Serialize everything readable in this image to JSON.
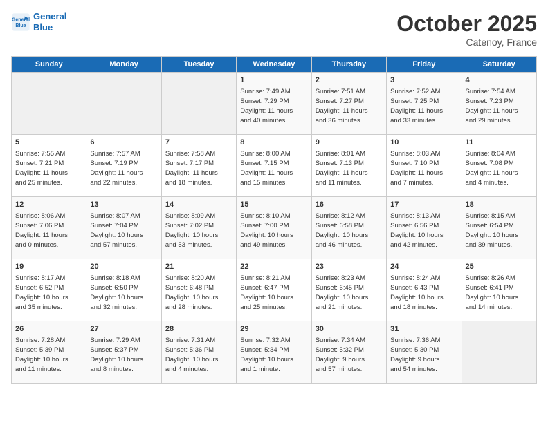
{
  "logo": {
    "line1": "General",
    "line2": "Blue"
  },
  "title": "October 2025",
  "location": "Catenoy, France",
  "days_of_week": [
    "Sunday",
    "Monday",
    "Tuesday",
    "Wednesday",
    "Thursday",
    "Friday",
    "Saturday"
  ],
  "weeks": [
    [
      {
        "day": "",
        "info": ""
      },
      {
        "day": "",
        "info": ""
      },
      {
        "day": "",
        "info": ""
      },
      {
        "day": "1",
        "info": "Sunrise: 7:49 AM\nSunset: 7:29 PM\nDaylight: 11 hours\nand 40 minutes."
      },
      {
        "day": "2",
        "info": "Sunrise: 7:51 AM\nSunset: 7:27 PM\nDaylight: 11 hours\nand 36 minutes."
      },
      {
        "day": "3",
        "info": "Sunrise: 7:52 AM\nSunset: 7:25 PM\nDaylight: 11 hours\nand 33 minutes."
      },
      {
        "day": "4",
        "info": "Sunrise: 7:54 AM\nSunset: 7:23 PM\nDaylight: 11 hours\nand 29 minutes."
      }
    ],
    [
      {
        "day": "5",
        "info": "Sunrise: 7:55 AM\nSunset: 7:21 PM\nDaylight: 11 hours\nand 25 minutes."
      },
      {
        "day": "6",
        "info": "Sunrise: 7:57 AM\nSunset: 7:19 PM\nDaylight: 11 hours\nand 22 minutes."
      },
      {
        "day": "7",
        "info": "Sunrise: 7:58 AM\nSunset: 7:17 PM\nDaylight: 11 hours\nand 18 minutes."
      },
      {
        "day": "8",
        "info": "Sunrise: 8:00 AM\nSunset: 7:15 PM\nDaylight: 11 hours\nand 15 minutes."
      },
      {
        "day": "9",
        "info": "Sunrise: 8:01 AM\nSunset: 7:13 PM\nDaylight: 11 hours\nand 11 minutes."
      },
      {
        "day": "10",
        "info": "Sunrise: 8:03 AM\nSunset: 7:10 PM\nDaylight: 11 hours\nand 7 minutes."
      },
      {
        "day": "11",
        "info": "Sunrise: 8:04 AM\nSunset: 7:08 PM\nDaylight: 11 hours\nand 4 minutes."
      }
    ],
    [
      {
        "day": "12",
        "info": "Sunrise: 8:06 AM\nSunset: 7:06 PM\nDaylight: 11 hours\nand 0 minutes."
      },
      {
        "day": "13",
        "info": "Sunrise: 8:07 AM\nSunset: 7:04 PM\nDaylight: 10 hours\nand 57 minutes."
      },
      {
        "day": "14",
        "info": "Sunrise: 8:09 AM\nSunset: 7:02 PM\nDaylight: 10 hours\nand 53 minutes."
      },
      {
        "day": "15",
        "info": "Sunrise: 8:10 AM\nSunset: 7:00 PM\nDaylight: 10 hours\nand 49 minutes."
      },
      {
        "day": "16",
        "info": "Sunrise: 8:12 AM\nSunset: 6:58 PM\nDaylight: 10 hours\nand 46 minutes."
      },
      {
        "day": "17",
        "info": "Sunrise: 8:13 AM\nSunset: 6:56 PM\nDaylight: 10 hours\nand 42 minutes."
      },
      {
        "day": "18",
        "info": "Sunrise: 8:15 AM\nSunset: 6:54 PM\nDaylight: 10 hours\nand 39 minutes."
      }
    ],
    [
      {
        "day": "19",
        "info": "Sunrise: 8:17 AM\nSunset: 6:52 PM\nDaylight: 10 hours\nand 35 minutes."
      },
      {
        "day": "20",
        "info": "Sunrise: 8:18 AM\nSunset: 6:50 PM\nDaylight: 10 hours\nand 32 minutes."
      },
      {
        "day": "21",
        "info": "Sunrise: 8:20 AM\nSunset: 6:48 PM\nDaylight: 10 hours\nand 28 minutes."
      },
      {
        "day": "22",
        "info": "Sunrise: 8:21 AM\nSunset: 6:47 PM\nDaylight: 10 hours\nand 25 minutes."
      },
      {
        "day": "23",
        "info": "Sunrise: 8:23 AM\nSunset: 6:45 PM\nDaylight: 10 hours\nand 21 minutes."
      },
      {
        "day": "24",
        "info": "Sunrise: 8:24 AM\nSunset: 6:43 PM\nDaylight: 10 hours\nand 18 minutes."
      },
      {
        "day": "25",
        "info": "Sunrise: 8:26 AM\nSunset: 6:41 PM\nDaylight: 10 hours\nand 14 minutes."
      }
    ],
    [
      {
        "day": "26",
        "info": "Sunrise: 7:28 AM\nSunset: 5:39 PM\nDaylight: 10 hours\nand 11 minutes."
      },
      {
        "day": "27",
        "info": "Sunrise: 7:29 AM\nSunset: 5:37 PM\nDaylight: 10 hours\nand 8 minutes."
      },
      {
        "day": "28",
        "info": "Sunrise: 7:31 AM\nSunset: 5:36 PM\nDaylight: 10 hours\nand 4 minutes."
      },
      {
        "day": "29",
        "info": "Sunrise: 7:32 AM\nSunset: 5:34 PM\nDaylight: 10 hours\nand 1 minute."
      },
      {
        "day": "30",
        "info": "Sunrise: 7:34 AM\nSunset: 5:32 PM\nDaylight: 9 hours\nand 57 minutes."
      },
      {
        "day": "31",
        "info": "Sunrise: 7:36 AM\nSunset: 5:30 PM\nDaylight: 9 hours\nand 54 minutes."
      },
      {
        "day": "",
        "info": ""
      }
    ]
  ]
}
